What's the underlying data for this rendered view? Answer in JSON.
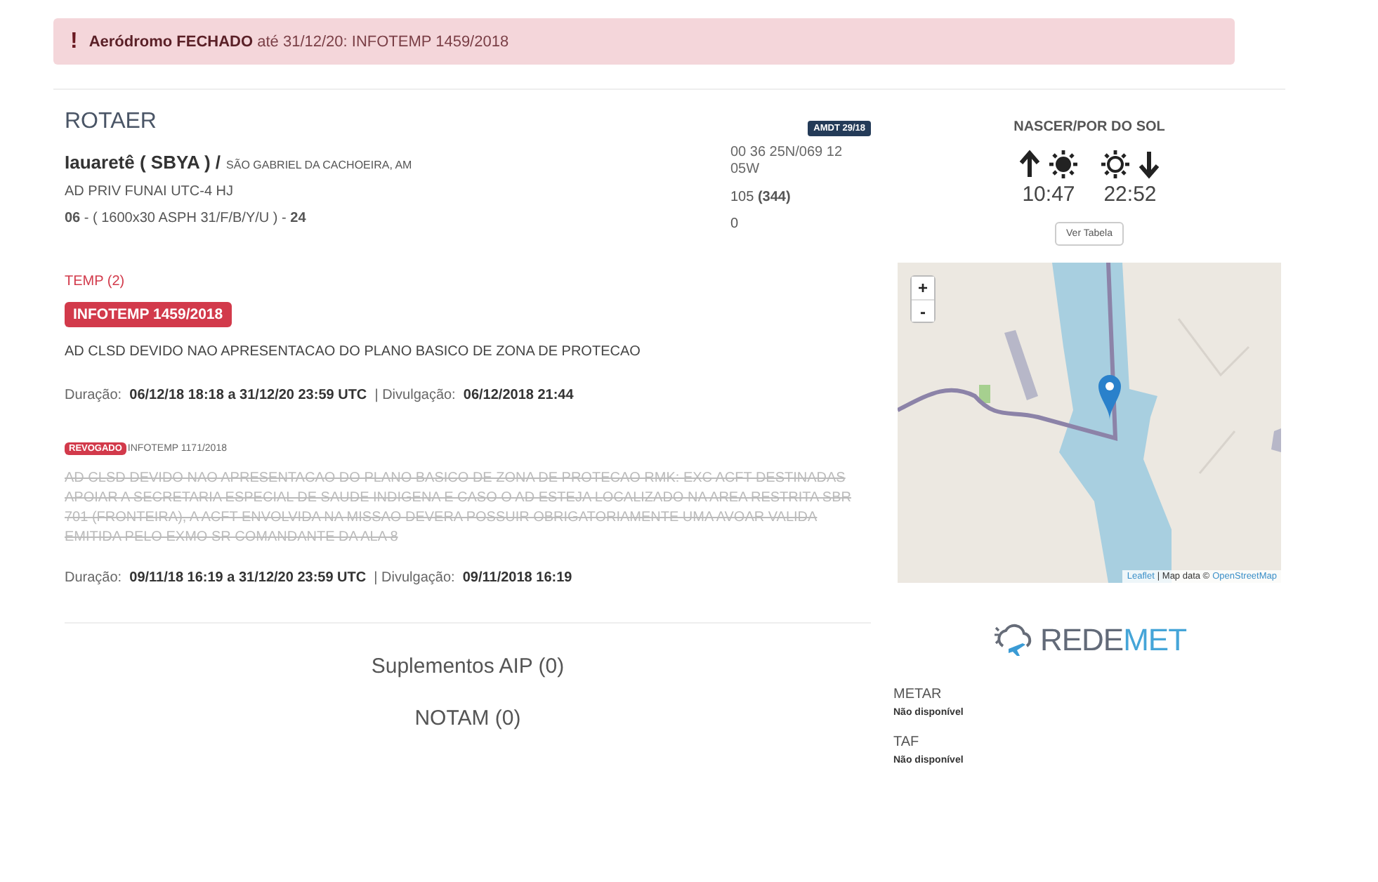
{
  "alert": {
    "icon": "!",
    "text": "**Aeródromo FECHADO** até 31/12/20: INFOTEMP 1459/2018"
  },
  "rotaer": {
    "title": "ROTAER",
    "amdt": "AMDT 29/18",
    "name": "Iauaretê ( SBYA ) /",
    "city": "SÃO GABRIEL DA CACHOEIRA, AM",
    "operator": "AD PRIV FUNAI UTC-4 HJ",
    "runway": "**06** - ( 1600x30 ASPH 31/F/B/Y/U ) - **24**",
    "coords": "00 36 25N/069 12 05W",
    "elevation": "105 **(344)**",
    "value_3": "0"
  },
  "temp": {
    "title": "TEMP (2)",
    "items": [
      {
        "kind": "active",
        "badge": "INFOTEMP 1459/2018",
        "text": "AD CLSD DEVIDO NAO APRESENTACAO DO PLANO BASICO DE ZONA DE PROTECAO",
        "details": "Duração:  **06/12/18 18:18 a 31/12/20 23:59 UTC**  | Divulgação:  **06/12/2018 21:44**"
      },
      {
        "kind": "revoked",
        "badge": "REVOGADO",
        "ref": "INFOTEMP 1171/2018",
        "text": "AD CLSD DEVIDO NAO APRESENTACAO DO PLANO BASICO DE ZONA DE PROTECAO RMK: EXC ACFT DESTINADAS APOIAR A SECRETARIA ESPECIAL DE SAUDE INDIGENA E CASO O AD ESTEJA LOCALIZADO NA AREA RESTRITA SBR 701 (FRONTEIRA), A ACFT ENVOLVIDA NA MISSAO DEVERA POSSUIR OBRIGATORIAMENTE UMA AVOAR VALIDA EMITIDA PELO EXMO SR COMANDANTE DA ALA 8",
        "details": "Duração:  **09/11/18 16:19 a 31/12/20 23:59 UTC**  | Divulgação:  **09/11/2018 16:19**"
      }
    ]
  },
  "links": [
    "Suplementos AIP (0)",
    "NOTAM (0)"
  ],
  "sun": {
    "title": "NASCER/POR DO SOL",
    "sunrise": "10:47",
    "sunset": "22:52",
    "button": "Ver Tabela"
  },
  "map": {
    "zoom_in": "+",
    "zoom_out": "-",
    "attribution_link_1": "Leaflet",
    "attribution_text": "| Map data ©",
    "attribution_link_2": "OpenStreetMap"
  },
  "logo": {
    "main": "REDE",
    "accent": "MET"
  },
  "weather": [
    {
      "label": "METAR",
      "value": "Não disponível"
    },
    {
      "label": "TAF",
      "value": "Não disponível"
    }
  ]
}
